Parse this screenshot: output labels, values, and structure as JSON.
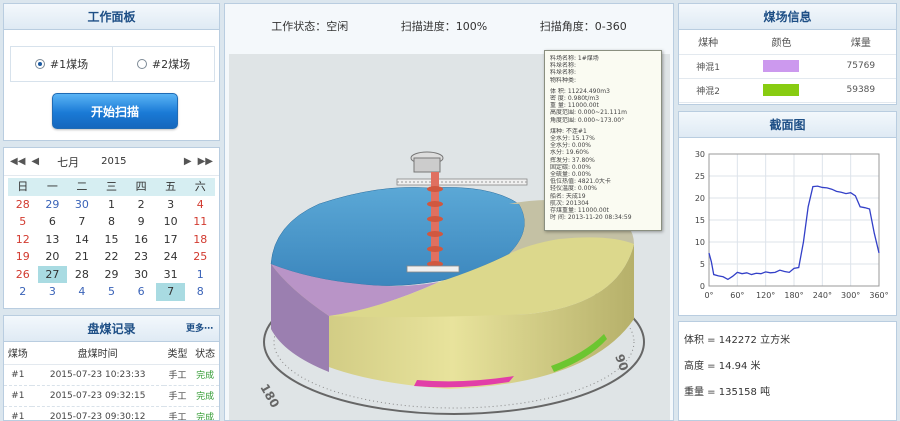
{
  "work_panel": {
    "title": "工作面板",
    "options": [
      {
        "label": "#1煤场",
        "checked": true
      },
      {
        "label": "#2煤场",
        "checked": false
      }
    ],
    "start_button": "开始扫描"
  },
  "calendar": {
    "prev_year": "◀◀",
    "prev_month": "◀",
    "next_month": "▶",
    "next_year": "▶▶",
    "month": "七月",
    "year": "2015",
    "weekdays": [
      "日",
      "一",
      "二",
      "三",
      "四",
      "五",
      "六"
    ],
    "days": [
      {
        "d": "28",
        "t": "red"
      },
      {
        "d": "29",
        "t": "other"
      },
      {
        "d": "30",
        "t": "other"
      },
      {
        "d": "1",
        "t": ""
      },
      {
        "d": "2",
        "t": ""
      },
      {
        "d": "3",
        "t": ""
      },
      {
        "d": "4",
        "t": "red"
      },
      {
        "d": "5",
        "t": "red"
      },
      {
        "d": "6",
        "t": ""
      },
      {
        "d": "7",
        "t": ""
      },
      {
        "d": "8",
        "t": ""
      },
      {
        "d": "9",
        "t": ""
      },
      {
        "d": "10",
        "t": ""
      },
      {
        "d": "11",
        "t": "red"
      },
      {
        "d": "12",
        "t": "red"
      },
      {
        "d": "13",
        "t": ""
      },
      {
        "d": "14",
        "t": ""
      },
      {
        "d": "15",
        "t": ""
      },
      {
        "d": "16",
        "t": ""
      },
      {
        "d": "17",
        "t": ""
      },
      {
        "d": "18",
        "t": "red"
      },
      {
        "d": "19",
        "t": "red"
      },
      {
        "d": "20",
        "t": ""
      },
      {
        "d": "21",
        "t": ""
      },
      {
        "d": "22",
        "t": ""
      },
      {
        "d": "23",
        "t": ""
      },
      {
        "d": "24",
        "t": ""
      },
      {
        "d": "25",
        "t": "red"
      },
      {
        "d": "26",
        "t": "red"
      },
      {
        "d": "27",
        "t": "today"
      },
      {
        "d": "28",
        "t": ""
      },
      {
        "d": "29",
        "t": ""
      },
      {
        "d": "30",
        "t": ""
      },
      {
        "d": "31",
        "t": ""
      },
      {
        "d": "1",
        "t": "other"
      },
      {
        "d": "2",
        "t": "other"
      },
      {
        "d": "3",
        "t": "other"
      },
      {
        "d": "4",
        "t": "other"
      },
      {
        "d": "5",
        "t": "other"
      },
      {
        "d": "6",
        "t": "other"
      },
      {
        "d": "7",
        "t": "today"
      },
      {
        "d": "8",
        "t": "other"
      }
    ]
  },
  "records": {
    "title": "盘煤记录",
    "more": "更多⋯",
    "headers": [
      "煤场",
      "盘煤时间",
      "类型",
      "状态"
    ],
    "rows": [
      [
        "#1",
        "2015-07-23 10:23:33",
        "手工",
        "完成"
      ],
      [
        "#1",
        "2015-07-23 09:32:15",
        "手工",
        "完成"
      ],
      [
        "#1",
        "2015-07-23 09:30:12",
        "手工",
        "完成"
      ]
    ]
  },
  "status": {
    "work_state": "工作状态：空闲",
    "progress": "扫描进度：100%",
    "angle": "扫描角度：0-360"
  },
  "info_box": {
    "lines": [
      "料场名称: 1#煤场",
      "料垛名称:",
      "料垛名称:",
      "物料种类:",
      "",
      "体    积: 11224.490m3",
      "密    度: 0.980t/m3",
      "重    量: 11000.00t",
      "高度范围: 0.000~21.111m",
      "角度范围: 0.000~173.00°",
      "",
      "煤种: 不连#1",
      "全水分: 15.17%",
      "全水分: 0.00%",
      "水分: 19.60%",
      "挥发分: 37.80%",
      "固定碳: 0.00%",
      "全硫量: 0.00%",
      "低位热值: 4821.0大卡",
      "轻仪温度: 0.00%",
      "船名: 天成19",
      "航次: 201304",
      "存煤重量: 11000.00t",
      "时    间: 2013-11-20 08:34:59"
    ]
  },
  "compass": {
    "label_90": "90",
    "label_180": "180"
  },
  "coal_info": {
    "title": "煤场信息",
    "headers": [
      "煤种",
      "颜色",
      "煤量"
    ],
    "rows": [
      {
        "name": "神混1",
        "color": "#cc99ee",
        "amount": "75769"
      },
      {
        "name": "神混2",
        "color": "#88cc11",
        "amount": "59389"
      }
    ]
  },
  "section_chart": {
    "title": "截面图",
    "chart_data": {
      "type": "line",
      "x": [
        0,
        5,
        10,
        20,
        30,
        40,
        50,
        60,
        70,
        80,
        90,
        100,
        110,
        120,
        130,
        140,
        150,
        160,
        170,
        180,
        190,
        200,
        210,
        220,
        230,
        240,
        250,
        260,
        270,
        280,
        290,
        300,
        310,
        320,
        330,
        340,
        350,
        360
      ],
      "y": [
        7.5,
        5.5,
        2.6,
        2.3,
        2.1,
        1.5,
        2.2,
        3.1,
        2.8,
        3.0,
        2.6,
        2.9,
        2.8,
        3.2,
        3.0,
        3.1,
        3.6,
        3.3,
        3.1,
        4.0,
        4.2,
        10.0,
        18.0,
        22.6,
        22.7,
        22.4,
        22.3,
        22.0,
        21.5,
        21.3,
        21.0,
        21.2,
        20.5,
        18.0,
        17.8,
        17.5,
        12.0,
        7.5
      ],
      "xticks": [
        "0°",
        "60°",
        "120°",
        "180°",
        "240°",
        "300°",
        "360°"
      ],
      "yticks": [
        "0",
        "5",
        "10",
        "15",
        "20",
        "25",
        "30"
      ],
      "xlim": [
        0,
        360
      ],
      "ylim": [
        0,
        30
      ],
      "line_color": "#3340c8",
      "grid": true
    }
  },
  "stats": {
    "volume": "体积 = 142272 立方米",
    "height": "高度 = 14.94 米",
    "weight": "重量 = 135158 吨"
  }
}
